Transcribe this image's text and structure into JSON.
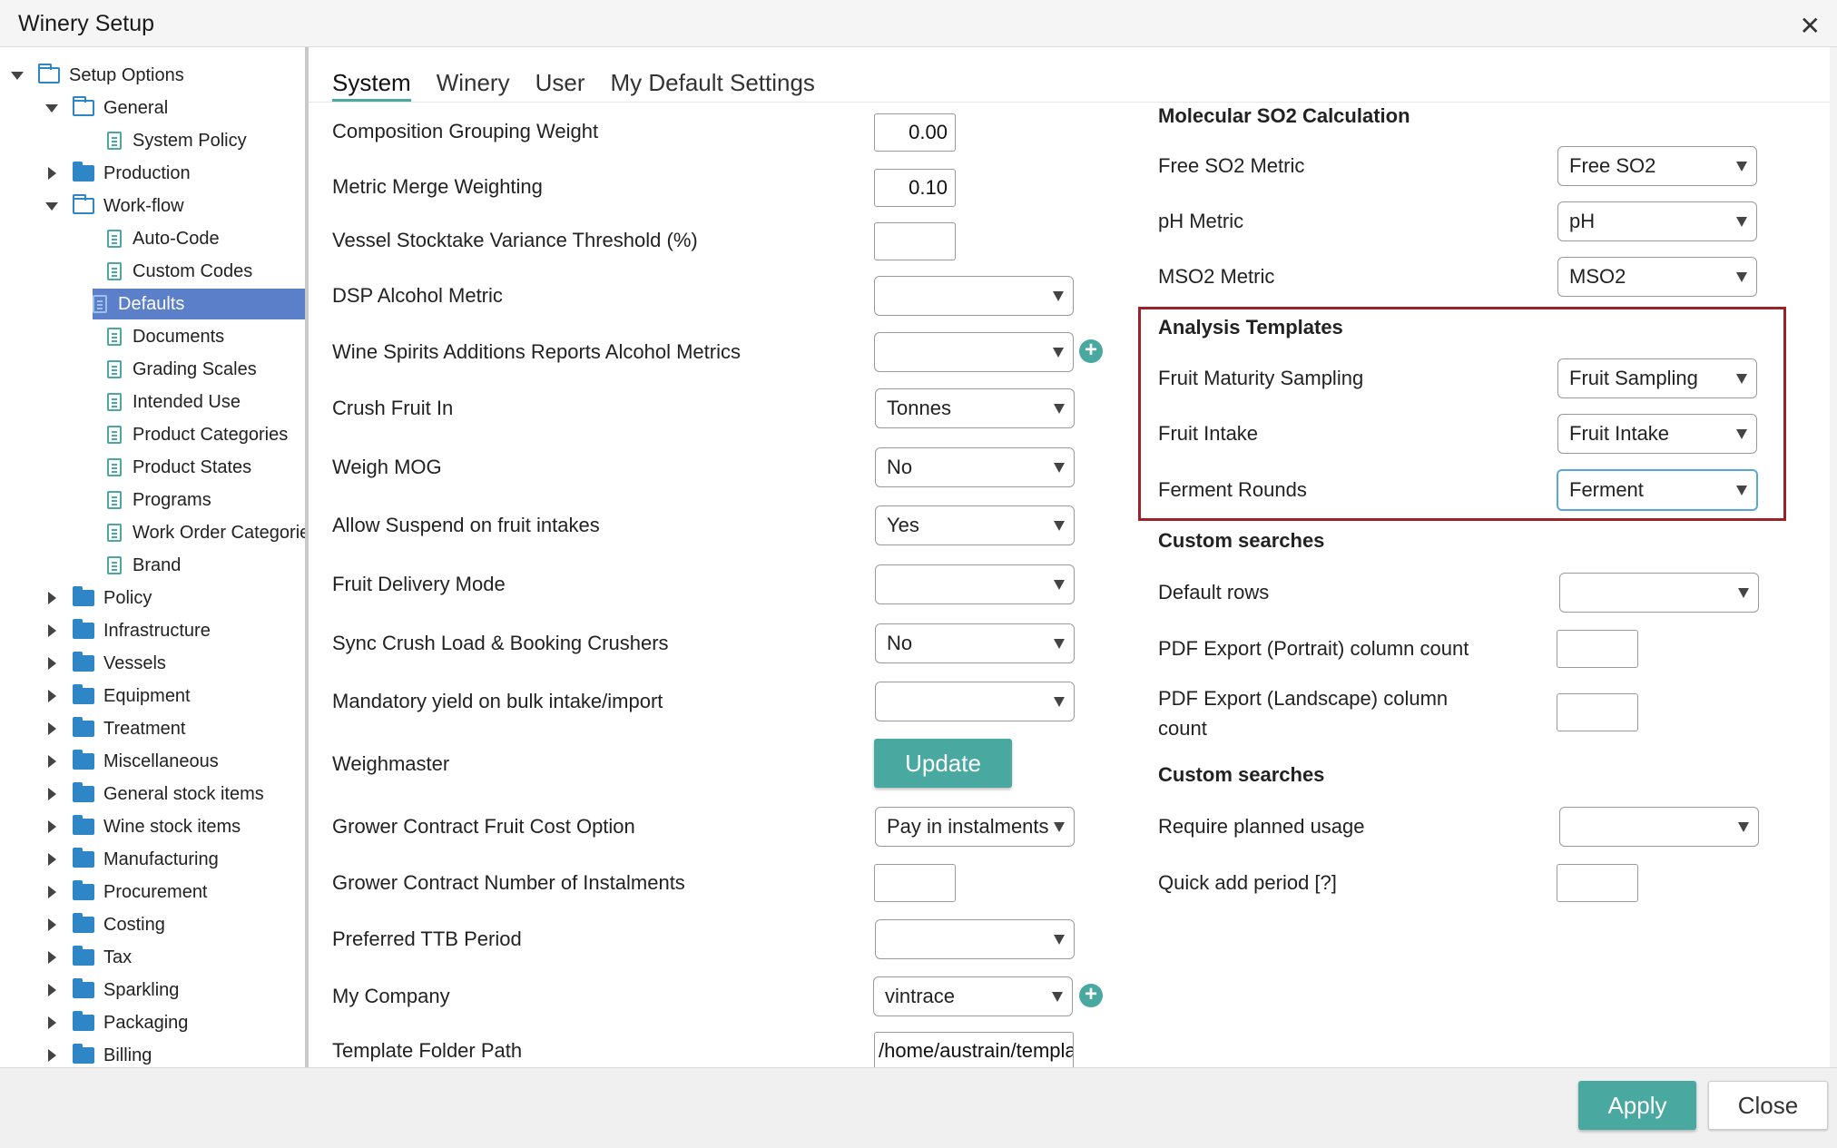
{
  "window": {
    "title": "Winery Setup",
    "close_symbol": "✕"
  },
  "tree": {
    "items": [
      {
        "label": "Setup Options",
        "level": 0,
        "expander": "down",
        "icon": "folder-open"
      },
      {
        "label": "General",
        "level": 1,
        "expander": "down",
        "icon": "folder-open"
      },
      {
        "label": "System Policy",
        "level": 2,
        "expander": "none",
        "icon": "doc"
      },
      {
        "label": "Production",
        "level": 1,
        "expander": "right",
        "icon": "folder"
      },
      {
        "label": "Work-flow",
        "level": 1,
        "expander": "down",
        "icon": "folder-open"
      },
      {
        "label": "Auto-Code",
        "level": 2,
        "expander": "none",
        "icon": "doc"
      },
      {
        "label": "Custom Codes",
        "level": 2,
        "expander": "none",
        "icon": "doc"
      },
      {
        "label": "Defaults",
        "level": 2,
        "expander": "none",
        "icon": "doc",
        "selected": true
      },
      {
        "label": "Documents",
        "level": 2,
        "expander": "none",
        "icon": "doc"
      },
      {
        "label": "Grading Scales",
        "level": 2,
        "expander": "none",
        "icon": "doc"
      },
      {
        "label": "Intended Use",
        "level": 2,
        "expander": "none",
        "icon": "doc"
      },
      {
        "label": "Product Categories",
        "level": 2,
        "expander": "none",
        "icon": "doc"
      },
      {
        "label": "Product States",
        "level": 2,
        "expander": "none",
        "icon": "doc"
      },
      {
        "label": "Programs",
        "level": 2,
        "expander": "none",
        "icon": "doc"
      },
      {
        "label": "Work Order Categories",
        "level": 2,
        "expander": "none",
        "icon": "doc"
      },
      {
        "label": "Brand",
        "level": 2,
        "expander": "none",
        "icon": "doc"
      },
      {
        "label": "Policy",
        "level": 1,
        "expander": "right",
        "icon": "folder"
      },
      {
        "label": "Infrastructure",
        "level": 1,
        "expander": "right",
        "icon": "folder"
      },
      {
        "label": "Vessels",
        "level": 1,
        "expander": "right",
        "icon": "folder"
      },
      {
        "label": "Equipment",
        "level": 1,
        "expander": "right",
        "icon": "folder"
      },
      {
        "label": "Treatment",
        "level": 1,
        "expander": "right",
        "icon": "folder"
      },
      {
        "label": "Miscellaneous",
        "level": 1,
        "expander": "right",
        "icon": "folder"
      },
      {
        "label": "General stock items",
        "level": 1,
        "expander": "right",
        "icon": "folder"
      },
      {
        "label": "Wine stock items",
        "level": 1,
        "expander": "right",
        "icon": "folder"
      },
      {
        "label": "Manufacturing",
        "level": 1,
        "expander": "right",
        "icon": "folder"
      },
      {
        "label": "Procurement",
        "level": 1,
        "expander": "right",
        "icon": "folder"
      },
      {
        "label": "Costing",
        "level": 1,
        "expander": "right",
        "icon": "folder"
      },
      {
        "label": "Tax",
        "level": 1,
        "expander": "right",
        "icon": "folder"
      },
      {
        "label": "Sparkling",
        "level": 1,
        "expander": "right",
        "icon": "folder"
      },
      {
        "label": "Packaging",
        "level": 1,
        "expander": "right",
        "icon": "folder"
      },
      {
        "label": "Billing",
        "level": 1,
        "expander": "right",
        "icon": "folder"
      }
    ]
  },
  "tabs": [
    {
      "label": "System",
      "active": true
    },
    {
      "label": "Winery"
    },
    {
      "label": "User"
    },
    {
      "label": "My Default Settings"
    }
  ],
  "left_form": {
    "composition_grouping_weight": {
      "label": "Composition Grouping Weight",
      "value": "0.00"
    },
    "metric_merge_weighting": {
      "label": "Metric Merge Weighting",
      "value": "0.10"
    },
    "vessel_stocktake_threshold": {
      "label": "Vessel Stocktake Variance Threshold (%)",
      "value": ""
    },
    "dsp_alcohol_metric": {
      "label": "DSP Alcohol Metric",
      "value": ""
    },
    "wine_spirits_additions": {
      "label": "Wine Spirits Additions Reports Alcohol Metrics",
      "value": ""
    },
    "crush_fruit_in": {
      "label": "Crush Fruit In",
      "value": "Tonnes"
    },
    "weigh_mog": {
      "label": "Weigh MOG",
      "value": "No"
    },
    "allow_suspend": {
      "label": "Allow Suspend on fruit intakes",
      "value": "Yes"
    },
    "fruit_delivery_mode": {
      "label": "Fruit Delivery Mode",
      "value": ""
    },
    "sync_crush_load": {
      "label": "Sync Crush Load & Booking Crushers",
      "value": "No"
    },
    "mandatory_yield": {
      "label": "Mandatory yield on bulk intake/import",
      "value": ""
    },
    "weighmaster": {
      "label": "Weighmaster",
      "button": "Update"
    },
    "grower_contract_cost": {
      "label": "Grower Contract Fruit Cost Option",
      "value": "Pay in instalments"
    },
    "grower_contract_instalments": {
      "label": "Grower Contract Number of Instalments",
      "value": ""
    },
    "preferred_ttb_period": {
      "label": "Preferred TTB Period",
      "value": ""
    },
    "my_company": {
      "label": "My Company",
      "value": "vintrace"
    },
    "template_folder_path": {
      "label": "Template Folder Path",
      "value": "/home/austrain/templates"
    }
  },
  "right_form": {
    "molecular_so2": {
      "heading": "Molecular SO2 Calculation",
      "free_so2": {
        "label": "Free SO2 Metric",
        "value": "Free SO2"
      },
      "ph": {
        "label": "pH Metric",
        "value": "pH"
      },
      "mso2": {
        "label": "MSO2 Metric",
        "value": "MSO2"
      }
    },
    "analysis_templates": {
      "heading": "Analysis Templates",
      "fruit_maturity": {
        "label": "Fruit Maturity Sampling",
        "value": "Fruit Sampling"
      },
      "fruit_intake": {
        "label": "Fruit Intake",
        "value": "Fruit Intake"
      },
      "ferment_rounds": {
        "label": "Ferment Rounds",
        "value": "Ferment"
      }
    },
    "custom_searches_1": {
      "heading": "Custom searches",
      "default_rows": {
        "label": "Default rows",
        "value": ""
      },
      "pdf_portrait": {
        "label": "PDF Export (Portrait) column count",
        "value": ""
      },
      "pdf_landscape_line1": "PDF Export (Landscape) column",
      "pdf_landscape_line2": "count",
      "pdf_landscape_value": ""
    },
    "custom_searches_2": {
      "heading": "Custom searches",
      "require_planned_usage": {
        "label": "Require planned usage",
        "value": ""
      },
      "quick_add_period": {
        "label": "Quick add period [?]",
        "value": ""
      }
    }
  },
  "footer": {
    "apply": "Apply",
    "close": "Close"
  },
  "colors": {
    "accent": "#49a89f",
    "selection": "#5b80c9",
    "highlight_border": "#9a2228",
    "folder": "#2f86c7"
  }
}
